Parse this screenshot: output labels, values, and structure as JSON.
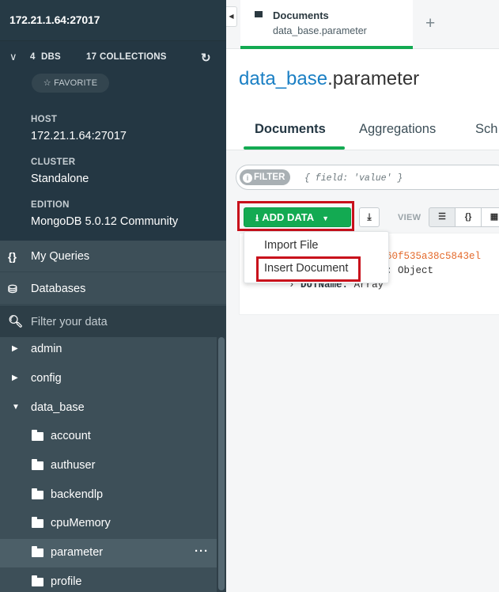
{
  "sidebar": {
    "connection_title": "172.21.1.64:27017",
    "db_count": "4",
    "db_label": "DBS",
    "collection_count": "17",
    "collection_label": "COLLECTIONS",
    "favorite_label": "FAVORITE",
    "host_label": "HOST",
    "host_value": "172.21.1.64:27017",
    "cluster_label": "CLUSTER",
    "cluster_value": "Standalone",
    "edition_label": "EDITION",
    "edition_value": "MongoDB 5.0.12 Community",
    "nav": {
      "my_queries": "My Queries",
      "databases": "Databases"
    },
    "filter_placeholder": "Filter your data",
    "tree": [
      {
        "label": "admin",
        "type": "database",
        "expanded": false
      },
      {
        "label": "config",
        "type": "database",
        "expanded": false
      },
      {
        "label": "data_base",
        "type": "database",
        "expanded": true
      },
      {
        "label": "account",
        "type": "collection"
      },
      {
        "label": "authuser",
        "type": "collection"
      },
      {
        "label": "backendlp",
        "type": "collection"
      },
      {
        "label": "cpuMemory",
        "type": "collection"
      },
      {
        "label": "parameter",
        "type": "collection",
        "active": true
      },
      {
        "label": "profile",
        "type": "collection"
      }
    ],
    "more_icon": "···"
  },
  "tab": {
    "title": "Documents",
    "subtitle": "data_base.parameter",
    "new_tab_icon": "+"
  },
  "namespace": {
    "db": "data_base",
    "collection": ".parameter"
  },
  "sub_tabs": {
    "documents": "Documents",
    "aggregations": "Aggregations",
    "schema": "Sch"
  },
  "toolbar": {
    "filter_badge": "FILTER",
    "filter_placeholder": "{ field: 'value' }",
    "add_data_label": "ADD DATA",
    "view_label": "VIEW",
    "view_json_icon": "{}"
  },
  "dropdown": {
    "import_file": "Import File",
    "insert_document": "Insert Document"
  },
  "document": {
    "id_value": "('60f535a38c5843el",
    "field2_tail": "ns:",
    "field2_value": "Object",
    "field3_key": "DUTName:",
    "field3_value": "Array"
  },
  "colors": {
    "sidebar_bg": "#3d4f58",
    "sidebar_dark": "#243743",
    "accent_green": "#13aa52",
    "link_blue": "#1a7fc4",
    "highlight_red": "#c8101b",
    "objectid_orange": "#e46a2b"
  }
}
